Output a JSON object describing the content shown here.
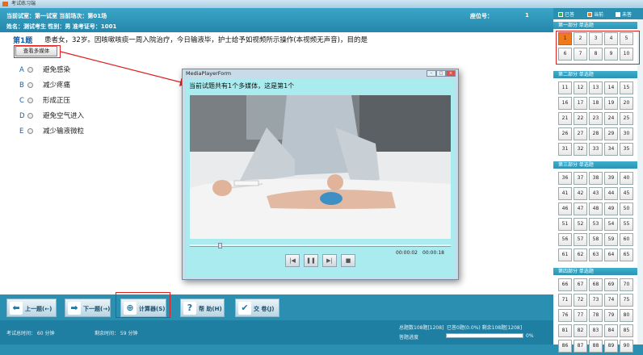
{
  "window": {
    "title": "考试练习端"
  },
  "header": {
    "line1": "当前试室：第一试室  当前场次：第01场",
    "line2": "姓名：测试考生   性别：男   准考证号：1001",
    "seat_label": "座位号：",
    "seat_value": "1"
  },
  "question": {
    "number": "第1题",
    "text": "患者女，32岁。因咳嗽咳痰一周入院治疗，今日输液毕，护士给予如视频所示操作(本视频无声音)，目的是",
    "media_button": "查看多媒体",
    "options": [
      {
        "letter": "A",
        "text": "避免感染"
      },
      {
        "letter": "B",
        "text": "减少疼痛"
      },
      {
        "letter": "C",
        "text": "形成正压"
      },
      {
        "letter": "D",
        "text": "避免空气进入"
      },
      {
        "letter": "E",
        "text": "减少输液微粒"
      }
    ]
  },
  "player": {
    "title": "MediaPlayerForm",
    "message": "当前试题共有1个多媒体，这是第1个",
    "time_current": "00:00:02",
    "time_total": "00:00:18",
    "progress": 0.11
  },
  "nav": {
    "prev": "上一题(←)",
    "next": "下一题(→)",
    "calc": "计算器(S)",
    "help": "帮  助(H)",
    "submit": "交  卷(J)"
  },
  "status": {
    "total_time": "考试总时间：  60 分钟",
    "remaining": "剩余时间：  59 分钟",
    "total_q": "总题数108题[1208]",
    "answered": "已答0题(0.0%)  剩余108题[1208]",
    "progress_label": "答题进度",
    "progress_pct": "0%"
  },
  "legend": {
    "answered": "已答",
    "current": "当前",
    "unanswered": "未答"
  },
  "sections": [
    {
      "title": "第一部分  单选题",
      "items": [
        "1",
        "2",
        "3",
        "4",
        "5",
        "6",
        "7",
        "8",
        "9",
        "10"
      ],
      "current": "1"
    },
    {
      "title": "第二部分  单选题",
      "items": [
        "11",
        "12",
        "13",
        "14",
        "15",
        "16",
        "17",
        "18",
        "19",
        "20",
        "21",
        "22",
        "23",
        "24",
        "25",
        "26",
        "27",
        "28",
        "29",
        "30",
        "31",
        "32",
        "33",
        "34",
        "35"
      ]
    },
    {
      "title": "第三部分  单选题",
      "items": [
        "36",
        "37",
        "38",
        "39",
        "40",
        "41",
        "42",
        "43",
        "44",
        "45",
        "46",
        "47",
        "48",
        "49",
        "50",
        "51",
        "52",
        "53",
        "54",
        "55",
        "56",
        "57",
        "58",
        "59",
        "60",
        "61",
        "62",
        "63",
        "64",
        "65"
      ]
    },
    {
      "title": "第四部分  单选题",
      "items": [
        "66",
        "67",
        "68",
        "69",
        "70",
        "71",
        "72",
        "73",
        "74",
        "75",
        "76",
        "77",
        "78",
        "79",
        "80",
        "81",
        "82",
        "83",
        "84",
        "85",
        "86",
        "87",
        "88",
        "89",
        "90"
      ]
    }
  ],
  "colors": {
    "accent": "#2a8fb0",
    "current": "#f07a1a",
    "highlight": "#d22222"
  }
}
